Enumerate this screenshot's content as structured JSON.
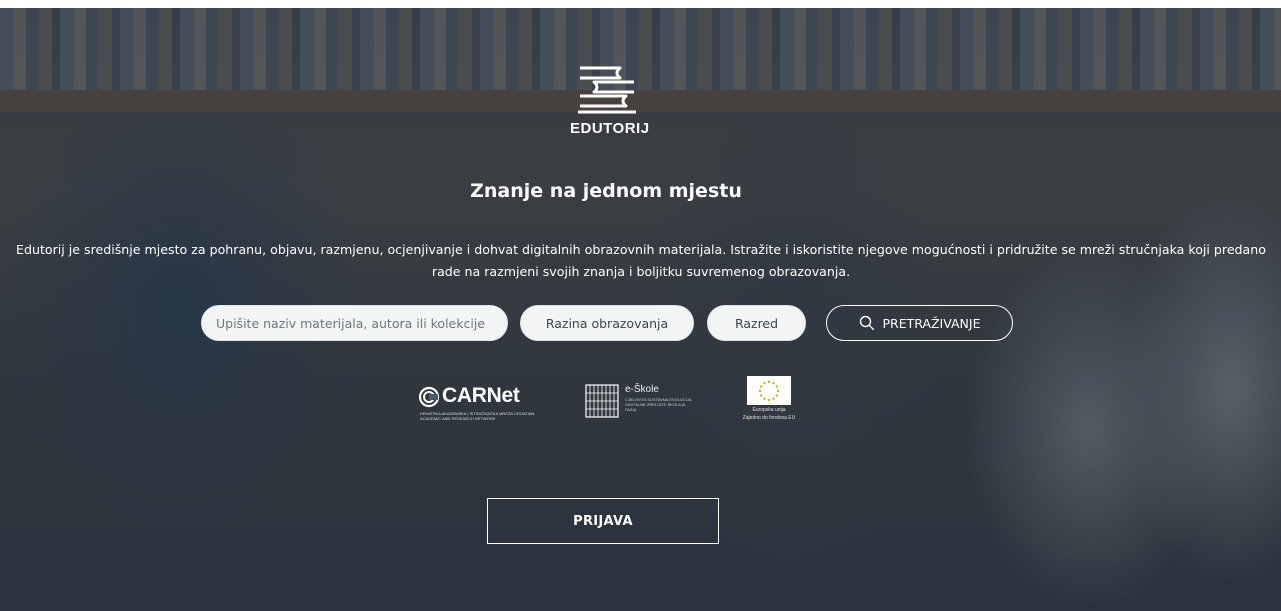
{
  "brand": {
    "logo_text": "EDUTORIJ",
    "logo_icon": "stacked-books-icon"
  },
  "hero": {
    "headline": "Znanje na jednom mjestu",
    "description": "Edutorij je središnje mjesto za pohranu, objavu, razmjenu, ocjenjivanje i dohvat digitalnih obrazovnih materijala. Istražite i iskoristite njegove mogućnosti i pridružite se mreži stručnjaka koji predano rade na razmjeni svojih znanja i boljitku suvremenog obrazovanja."
  },
  "search": {
    "placeholder": "Upišite naziv materijala, autora ili kolekcije",
    "level_label": "Razina obrazovanja",
    "grade_label": "Razred",
    "button_label": "PRETRAŽIVANJE",
    "button_icon": "search-icon"
  },
  "partners": {
    "carnet": {
      "name": "CARNet",
      "subtitle": "HRVATSKA AKADEMSKA I ISTRAŽIVAČKA MREŽA CROATIAN ACADEMIC AND RESEARCH NETWORK"
    },
    "eskole": {
      "name": "e-Škole",
      "subtitle": "CJELOVITA SUSTAVNA EVOLUCIJA DIGITALNE ZRELOSTI ŠKOLA (II. FAZA)"
    },
    "eu": {
      "line1": "Europska unija",
      "line2": "Zajedno do fondova EU"
    }
  },
  "auth": {
    "login_label": "PRIJAVA"
  },
  "colors": {
    "overlay": "#1e2c3a",
    "text": "#ffffff",
    "pill_bg": "#ffffff"
  }
}
